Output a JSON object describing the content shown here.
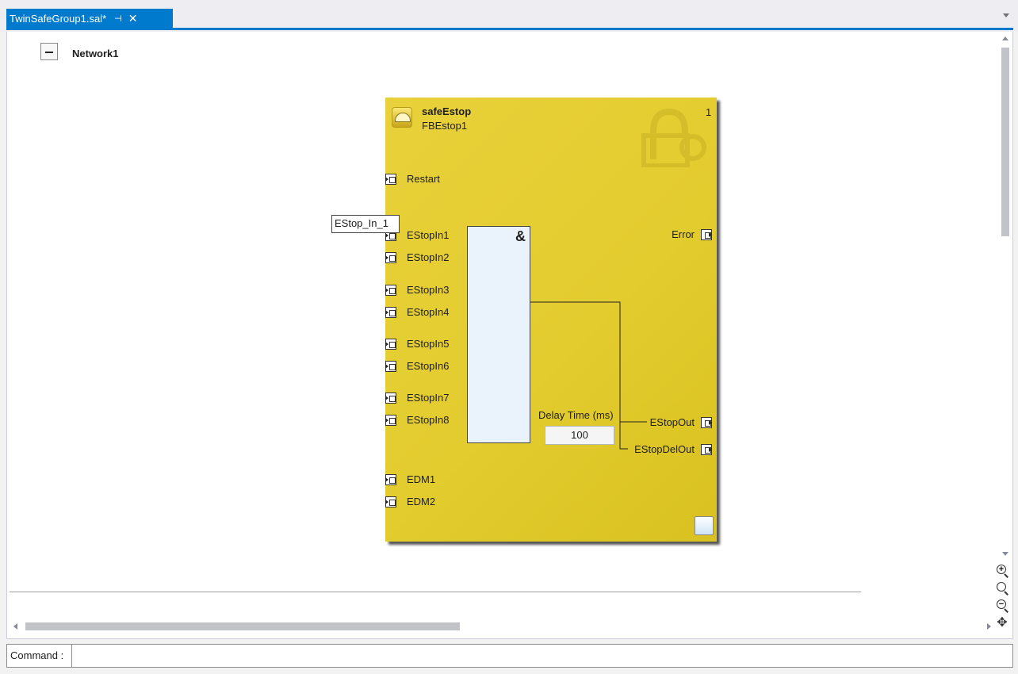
{
  "tab": {
    "title": "TwinSafeGroup1.sal*",
    "pin_icon": "⊣",
    "close_icon": "✕"
  },
  "network": {
    "label": "Network1",
    "collapse_icon": "minus-icon"
  },
  "function_block": {
    "type_name": "safeEstop",
    "instance_name": "FBEstop1",
    "number": "1",
    "icon": "estop-icon",
    "color": "#e6cf35",
    "inputs": [
      "Restart",
      "EStopIn1",
      "EStopIn2",
      "EStopIn3",
      "EStopIn4",
      "EStopIn5",
      "EStopIn6",
      "EStopIn7",
      "EStopIn8",
      "EDM1",
      "EDM2"
    ],
    "outputs": [
      "Error",
      "EStopOut",
      "EStopDelOut"
    ],
    "and_symbol": "&",
    "delay_label": "Delay Time (ms)",
    "delay_value": "100"
  },
  "edit_box": {
    "value": "EStop_In_1"
  },
  "zoom_tools": [
    "zoom-in-icon",
    "zoom-reset-icon",
    "zoom-out-icon",
    "pan-icon"
  ],
  "command_bar": {
    "label": "Command :",
    "value": ""
  },
  "colors": {
    "accent": "#007acc",
    "gate_fill": "#eaf3fb"
  }
}
